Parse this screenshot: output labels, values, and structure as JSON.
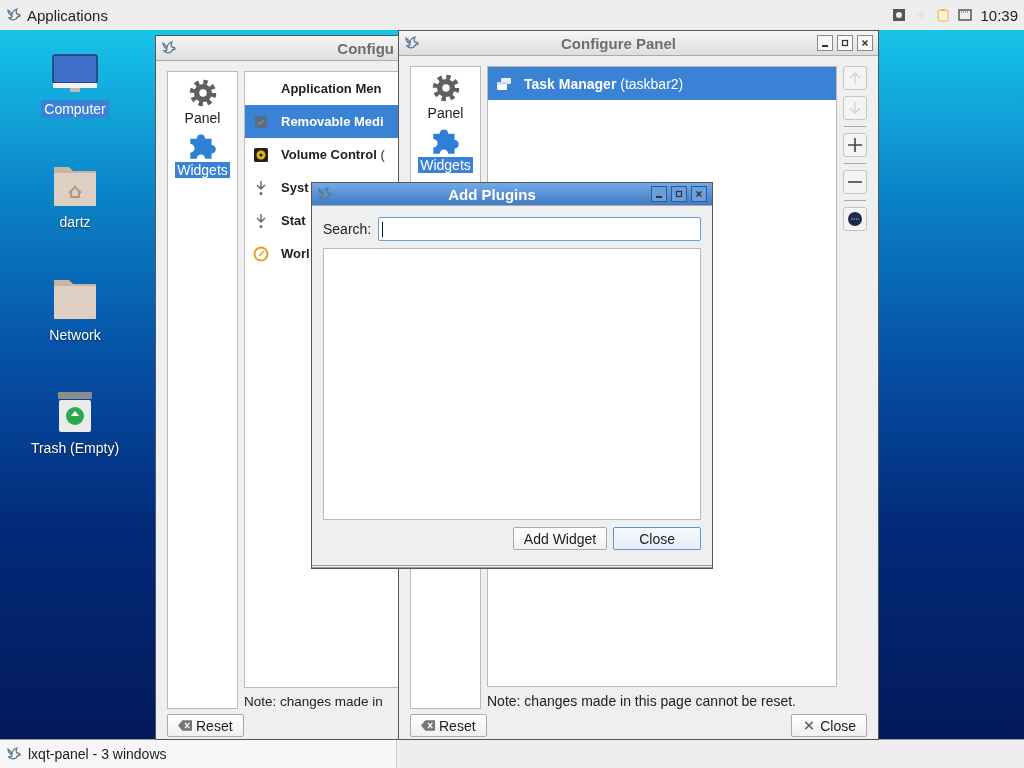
{
  "top_panel": {
    "menu_label": "Applications",
    "clock": "10:39"
  },
  "desktop_icons": [
    {
      "label": "Computer",
      "kind": "computer",
      "selected": true
    },
    {
      "label": "dartz",
      "kind": "home",
      "selected": false
    },
    {
      "label": "Network",
      "kind": "folder",
      "selected": false
    },
    {
      "label": "Trash (Empty)",
      "kind": "trash",
      "selected": false
    }
  ],
  "config_windows": [
    {
      "title": "Configu",
      "active": false,
      "sidebar": [
        {
          "label": "Panel",
          "kind": "gear",
          "selected": false
        },
        {
          "label": "Widgets",
          "kind": "puzzle",
          "selected": true
        }
      ],
      "plugins": [
        {
          "name": "Application Men",
          "kind": "none",
          "selected": false
        },
        {
          "name": "Removable Medi",
          "kind": "drive",
          "selected": true
        },
        {
          "name": "Volume Control",
          "detail": "(",
          "kind": "speaker",
          "selected": false
        },
        {
          "name": "Syst",
          "kind": "tray",
          "selected": false
        },
        {
          "name": "Stat",
          "kind": "tray",
          "selected": false
        },
        {
          "name": "Worl",
          "kind": "clock",
          "selected": false
        }
      ],
      "note": "Note: changes made in",
      "buttons": [
        {
          "label": "Reset",
          "kind": "reset"
        }
      ]
    },
    {
      "title": "Configure Panel",
      "active": false,
      "window_controls": [
        {
          "kind": "minimize"
        },
        {
          "kind": "maximize"
        },
        {
          "kind": "close"
        }
      ],
      "sidebar": [
        {
          "label": "Panel",
          "kind": "gear",
          "selected": false
        },
        {
          "label": "Widgets",
          "kind": "puzzle",
          "selected": true
        }
      ],
      "plugins": [
        {
          "name": "Task Manager",
          "detail": "(taskbar2)",
          "kind": "windows",
          "selected": true
        }
      ],
      "tools": [
        {
          "kind": "up",
          "disabled": true
        },
        {
          "kind": "down",
          "disabled": true
        },
        {
          "kind": "add",
          "disabled": false
        },
        {
          "kind": "remove",
          "disabled": false
        },
        {
          "kind": "info",
          "disabled": false
        }
      ],
      "note": "Note: changes made in this page cannot be reset.",
      "buttons": [
        {
          "label": "Reset",
          "kind": "reset"
        },
        {
          "label": "Close",
          "kind": "close"
        }
      ]
    }
  ],
  "add_plugins_dialog": {
    "title": "Add Plugins",
    "active": true,
    "window_controls": [
      {
        "kind": "minimize"
      },
      {
        "kind": "maximize"
      },
      {
        "kind": "close"
      }
    ],
    "search_label": "Search:",
    "search_focused": true,
    "buttons": [
      {
        "label": "Add Widget",
        "default": false
      },
      {
        "label": "Close",
        "default": true
      }
    ]
  },
  "taskbar": {
    "task_label": "lxqt-panel - 3 windows"
  }
}
